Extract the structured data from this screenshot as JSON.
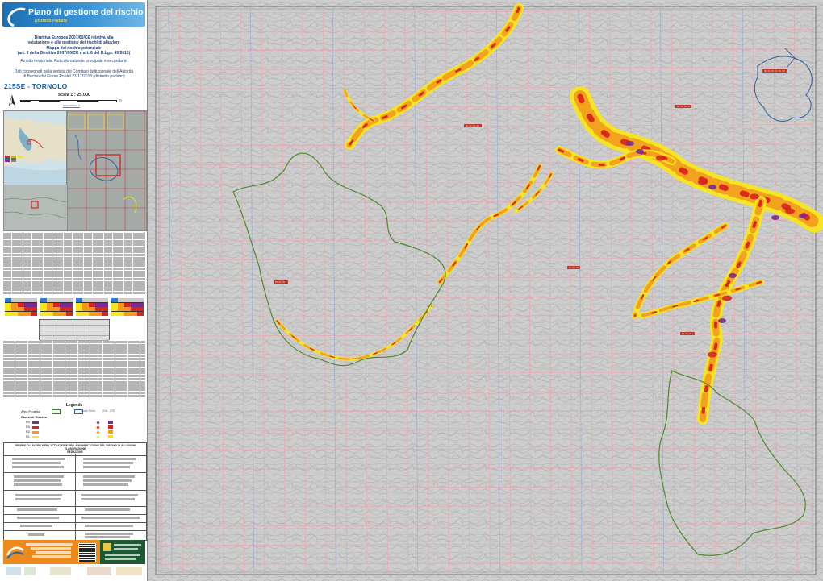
{
  "header": {
    "title": "Piano di gestione del rischio di alluvioni",
    "subtitle": "Distretto Padano"
  },
  "directive": {
    "line1": "Direttiva Europea 2007/60/CE relativa alla",
    "line2": "valutazione e alla gestione dei rischi di alluvioni",
    "line3": "Mappa del rischio potenziale",
    "line4": "(art. 6 della Direttiva 2007/60/CE e art. 6 del D.Lgs. 49/2010)"
  },
  "ambito": "Ambito territoriale: Reticolo naturale principale e secondario",
  "dati": {
    "line1": "Dati consegnati nella seduta del Comitato Istituzionale dell'Autorità",
    "line2": "di Bacino del Fiume Po del 23/12/2013 (distretto padano)"
  },
  "sheet_title": "215SE - TORNOLO",
  "scale": {
    "label": "scala 1 : 25.000",
    "ticks": [
      "0",
      "250",
      "500",
      "1000",
      "1500",
      "2000"
    ],
    "unit": "m",
    "link": "www.adbpo.it"
  },
  "legend": {
    "title": "Legenda",
    "area_label": "Area Protetta",
    "zone_label": "Zone Prive",
    "tile_label": "215 - 27E",
    "classi_label": "Classi di Rischio",
    "classes": [
      "R4",
      "R3",
      "R2",
      "R1"
    ],
    "colors": {
      "R4": "#7b2a8f",
      "R3": "#d8231e",
      "R2": "#f39a1d",
      "R1": "#f5e61e"
    }
  },
  "info": {
    "heading1": "GRUPPO DI LAVORO PER L'ATTUAZIONE DELLA PIANIFICAZIONE DEL RISCHIO DI ALLUVIONI",
    "heading2": "ELABORAZIONE",
    "heading3": "REDAZIONE"
  },
  "colors": {
    "brand_blue": "#1b6fb3",
    "map_background": "#c9c9c9",
    "grid_red": "#e8a8b0",
    "grid_blue": "#8da4d6",
    "boundary_green": "#4c8a2e",
    "boundary_blue": "#2d5fa0",
    "label_red": "#c0392b",
    "footer_orange": "#ee8a1b",
    "footer_green": "#1d5a34"
  },
  "icons": {
    "north_arrow": "north-arrow-icon",
    "wave_logo": "wave-logo-icon",
    "qr_code": "qr-code-icon"
  }
}
